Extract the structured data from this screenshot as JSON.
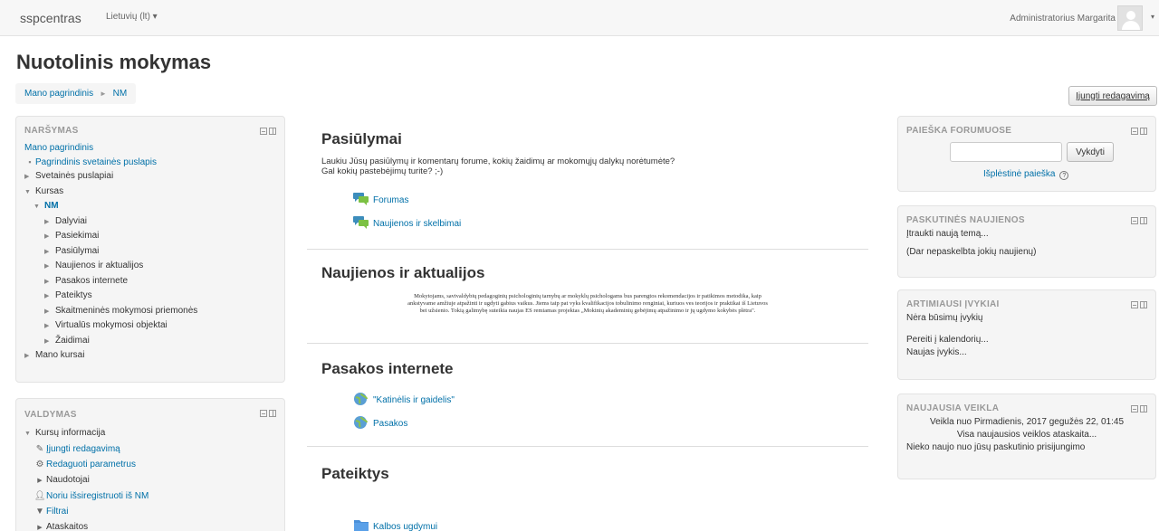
{
  "navbar": {
    "brand": "sspcentras",
    "language": "Lietuvių (lt) ▾",
    "user": "Administratorius Margarita",
    "caret": "▾"
  },
  "page": {
    "title": "Nuotolinis mokymas",
    "edit_button": "Įjungti redagavimą"
  },
  "breadcrumb": {
    "items": [
      "Mano pagrindinis",
      "NM"
    ],
    "separator": "►"
  },
  "navigation": {
    "title": "NARŠYMAS",
    "home": "Mano pagrindinis",
    "site_home": "Pagrindinis svetainės puslapis",
    "site_pages": "Svetainės puslapiai",
    "courses": "Kursas",
    "course": "NM",
    "course_items": [
      "Dalyviai",
      "Pasiekimai",
      "Pasiūlymai",
      "Naujienos ir aktualijos",
      "Pasakos internete",
      "Pateiktys",
      "Skaitmeninės mokymosi priemonės",
      "Virtualūs mokymosi objektai",
      "Žaidimai"
    ],
    "my_courses": "Mano kursai"
  },
  "admin": {
    "title": "VALDYMAS",
    "course_admin": "Kursų informacija",
    "items": [
      "Įjungti redagavimą",
      "Redaguoti parametrus",
      "Naudotojai",
      "Noriu išsiregistruoti iš NM",
      "Filtrai",
      "Ataskaitos"
    ]
  },
  "sections": {
    "s1": {
      "title": "Pasiūlymai",
      "summary_1": "Laukiu Jūsų pasiūlymų ir komentarų forume, kokių žaidimų ar mokomųjų dalykų norėtumėte?",
      "summary_2": "Gal kokių pastebėjimų turite? ;-)",
      "activities": [
        "Forumas",
        "Naujienos ir skelbimai"
      ]
    },
    "s2": {
      "title": "Naujienos ir aktualijos",
      "text_1": "Mokytojams, savivaldybių pedagoginių psichologinių tarnybų ar mokyklų psichologams bus parengtos rekomendacijos ir patikimos metodika, kaip",
      "text_2": "ankstyvame amžiuje atpažinti ir ugdyti gabius vaikus. Jiems taip pat vyks kvalifikacijos tobulinimo renginiai, kuriuos ves teorijos ir praktikai iš Lietuvos",
      "text_3": "bei užsienio. Tokią galimybę suteikia naujas ES remiamas projektas „Mokinių akademinių gebėjimų atpažinimo ir jų ugdymo kokybės plėtra\"."
    },
    "s3": {
      "title": "Pasakos internete",
      "activities": [
        "\"Katinėlis ir gaidelis\"",
        "Pasakos"
      ]
    },
    "s4": {
      "title": "Pateiktys",
      "activities": [
        "Kalbos ugdymui"
      ]
    }
  },
  "forum_search": {
    "title": "PAIEŠKA FORUMUOSE",
    "button": "Vykdyti",
    "advanced": "Išplėstinė paieška",
    "help": "?"
  },
  "latest_news": {
    "title": "PASKUTINĖS NAUJIENOS",
    "add": "Įtraukti naują temą...",
    "empty": "(Dar nepaskelbta jokių naujienų)"
  },
  "events": {
    "title": "ARTIMIAUSI ĮVYKIAI",
    "none": "Nėra būsimų įvykių",
    "calendar": "Pereiti į kalendorių...",
    "new_event": "Naujas įvykis..."
  },
  "recent": {
    "title": "NAUJAUSIA VEIKLA",
    "since": "Veikla nuo Pirmadienis, 2017 gegužės 22, 01:45",
    "full_report": "Visa naujausios veiklos ataskaita...",
    "nothing": "Nieko naujo nuo jūsų paskutinio prisijungimo"
  },
  "colors": {
    "link": "#0070a8",
    "block_bg": "#f5f5f5",
    "navbar_bg": "#f7f7f7"
  },
  "icons": {
    "forum": "forum-icon",
    "url": "url-icon",
    "folder": "folder-icon",
    "pencil": "pencil-icon",
    "gear": "gear-icon",
    "user": "user-icon",
    "filter": "filter-icon"
  }
}
